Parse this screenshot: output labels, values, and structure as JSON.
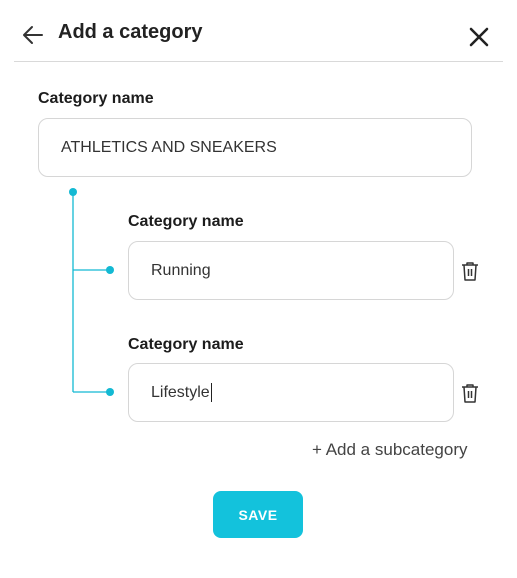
{
  "header": {
    "title": "Add a category",
    "back_icon": "arrow-left-icon",
    "close_icon": "close-icon"
  },
  "category": {
    "label": "Category name",
    "value": "ATHLETICS AND SNEAKERS"
  },
  "subcategories": [
    {
      "label": "Category name",
      "value": "Running",
      "delete_icon": "trash-icon"
    },
    {
      "label": "Category name",
      "value": "Lifestyle",
      "delete_icon": "trash-icon"
    }
  ],
  "add_subcategory_label": "+ Add a subcategory",
  "save_label": "SAVE",
  "colors": {
    "accent": "#13c2dc",
    "tree_line": "#13b9d3"
  }
}
